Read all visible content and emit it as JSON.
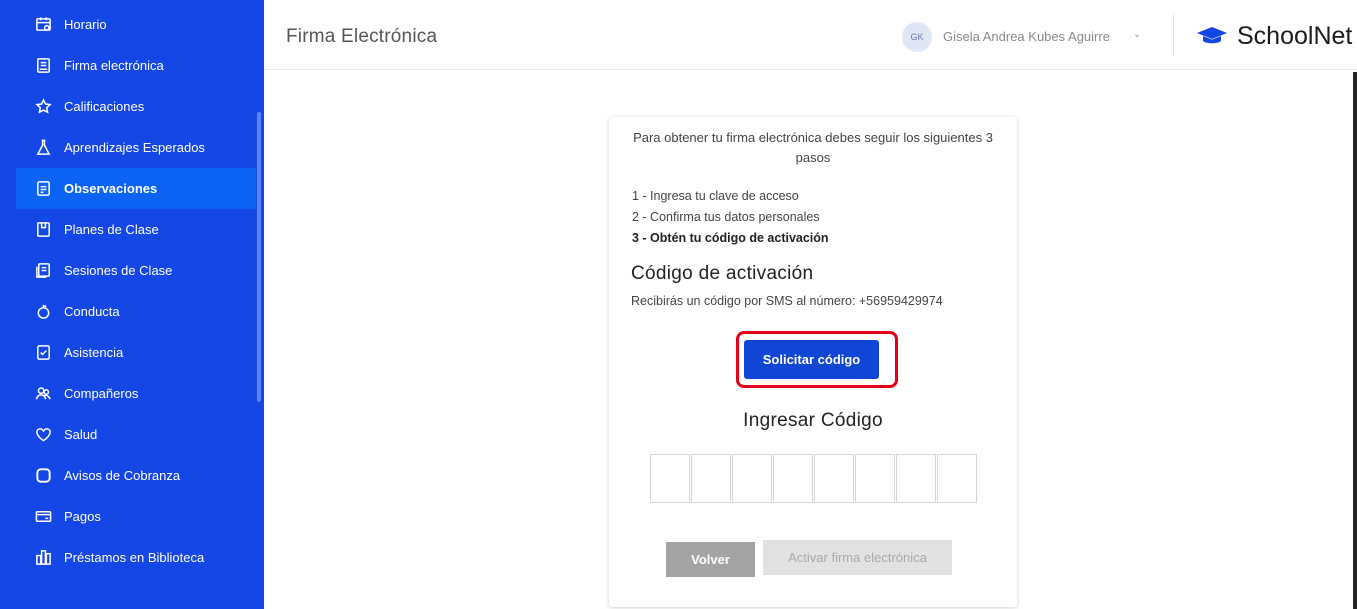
{
  "sidebar": {
    "items": [
      {
        "label": "Horario",
        "icon": "calendar-icon"
      },
      {
        "label": "Firma electrónica",
        "icon": "document-signature-icon"
      },
      {
        "label": "Calificaciones",
        "icon": "star-icon"
      },
      {
        "label": "Aprendizajes Esperados",
        "icon": "flask-icon"
      },
      {
        "label": "Observaciones",
        "icon": "note-icon",
        "active": true
      },
      {
        "label": "Planes de Clase",
        "icon": "plan-icon"
      },
      {
        "label": "Sesiones de Clase",
        "icon": "sessions-icon"
      },
      {
        "label": "Conducta",
        "icon": "apple-icon"
      },
      {
        "label": "Asistencia",
        "icon": "attendance-icon"
      },
      {
        "label": "Compañeros",
        "icon": "people-icon"
      },
      {
        "label": "Salud",
        "icon": "heart-icon"
      },
      {
        "label": "Avisos de Cobranza",
        "icon": "square-icon"
      },
      {
        "label": "Pagos",
        "icon": "card-icon"
      },
      {
        "label": "Préstamos en Biblioteca",
        "icon": "library-icon"
      }
    ]
  },
  "header": {
    "title": "Firma Electrónica",
    "user_initials": "GK",
    "user_name": "Gisela Andrea Kubes Aguirre",
    "user_chevron": "⌄",
    "brand": "SchoolNet"
  },
  "card": {
    "intro": "Para obtener tu firma electrónica debes seguir los siguientes 3 pasos",
    "steps": [
      "1 - Ingresa tu clave de acceso",
      "2 - Confirma tus datos personales",
      "3 - Obtén tu código de activación"
    ],
    "code_title": "Código de activación",
    "sms_text": "Recibirás un código por SMS al número: +56959429974",
    "request_button": "Solicitar código",
    "enter_code_title": "Ingresar Código",
    "code_box_count": 8,
    "back_button": "Volver",
    "activate_button": "Activar firma electrónica"
  },
  "colors": {
    "sidebar": "#1447e6",
    "sidebar_active": "#0a63f5",
    "primary_button": "#0f46d6",
    "highlight_outline": "#e5001a"
  }
}
